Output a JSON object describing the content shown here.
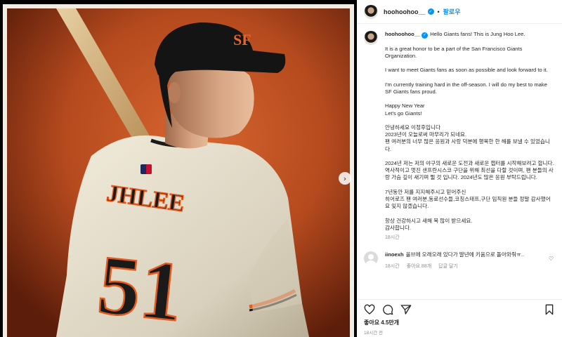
{
  "header": {
    "username": "hoohoohoo__",
    "follow_label": "팔로우",
    "dot": "•"
  },
  "caption": {
    "username": "hoohoohoo__",
    "paragraphs": [
      "Hello Giants fans! This is Jung Hoo Lee.",
      "It is a great honor to be a part of the San Francisco Giants Organization.",
      "I want to meet Giants fans as soon as possible and look forward to it.",
      "I'm currently training hard in the off-season. I will do my best to make SF Giants fans proud.",
      "Happy New Year\nLet's go Giants!",
      "안녕하세요 이정후입니다\n2023년이 오늘로써 마무리가 되네요.\n팬 여러분의 너무 많은 응원과 사랑 덕분에 행복한 한 해를 보낼 수 있었습니다.",
      "2024년 저는 저의 야구의 새로운 도전과 새로운 챕터를 시작해보려고 합니다. 역사적이고 멋진 샌프란시스코 구단을 위해 최선을 다할 것이며, 팬 분들의 사랑 가슴 깊이 새기며 뛸 것 입니다. 2024년도 많은 응원 부탁드립니다.",
      "7년동안 저를 지지해주시고 믿어주신\n히어로즈 팬 여러분,동료선수들,코칭스태프,구단 임직원 분들 정말 감사했어요 잊지 않겠습니다.",
      "항상 건강하시고 새해 복 많이 받으세요.\n감사합니다."
    ],
    "time": "18시간"
  },
  "comment": {
    "username": "iinoexh",
    "text": "올브에 오래오래 있다가 말년에 키움으로 돌아와줘ㅠ..",
    "time": "18시간",
    "likes": "좋아요 88개",
    "reply": "답글 달기"
  },
  "post": {
    "likes": "좋아요 4.5만개",
    "time": "18시간 전"
  },
  "photo": {
    "jersey_name": "JHLEE",
    "jersey_number": "51",
    "cap_logo": "SF"
  },
  "colors": {
    "background": "#b84a1f",
    "jersey": "#ece6d3",
    "accent": "#f26522",
    "link": "#0095f6"
  },
  "icons": [
    "heart-icon",
    "comment-icon",
    "share-icon",
    "bookmark-icon",
    "verified-badge-icon",
    "chevron-right-icon"
  ]
}
